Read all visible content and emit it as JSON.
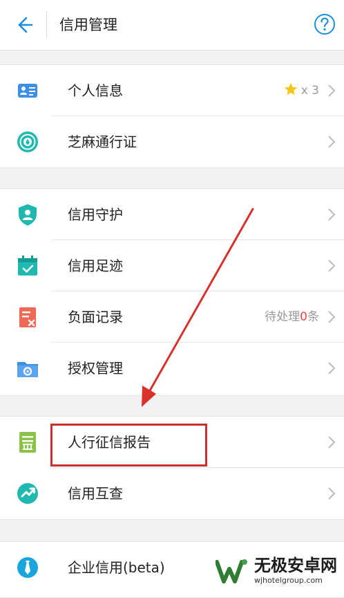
{
  "header": {
    "title": "信用管理"
  },
  "groups": [
    {
      "rows": [
        {
          "label": "个人信息",
          "icon": "id-card-icon",
          "star_count": "x 3"
        },
        {
          "label": "芝麻通行证",
          "icon": "sesame-passport-icon"
        }
      ]
    },
    {
      "rows": [
        {
          "label": "信用守护",
          "icon": "shield-user-icon"
        },
        {
          "label": "信用足迹",
          "icon": "calendar-check-icon"
        },
        {
          "label": "负面记录",
          "icon": "negative-record-icon",
          "status_prefix": "待处理",
          "status_count": "0",
          "status_suffix": "条"
        },
        {
          "label": "授权管理",
          "icon": "folder-gear-icon"
        }
      ]
    },
    {
      "rows": [
        {
          "label": "人行征信报告",
          "icon": "bank-report-icon"
        },
        {
          "label": "信用互查",
          "icon": "mutual-check-icon"
        }
      ]
    },
    {
      "rows": [
        {
          "label": "企业信用(beta)",
          "icon": "tie-icon"
        }
      ]
    }
  ],
  "watermark": {
    "name": "无极安卓网",
    "url": "wjhotelgroup.com"
  },
  "colors": {
    "accent": "#1a8fe0",
    "annotation": "#d9302b",
    "warning_count": "#f04444"
  }
}
